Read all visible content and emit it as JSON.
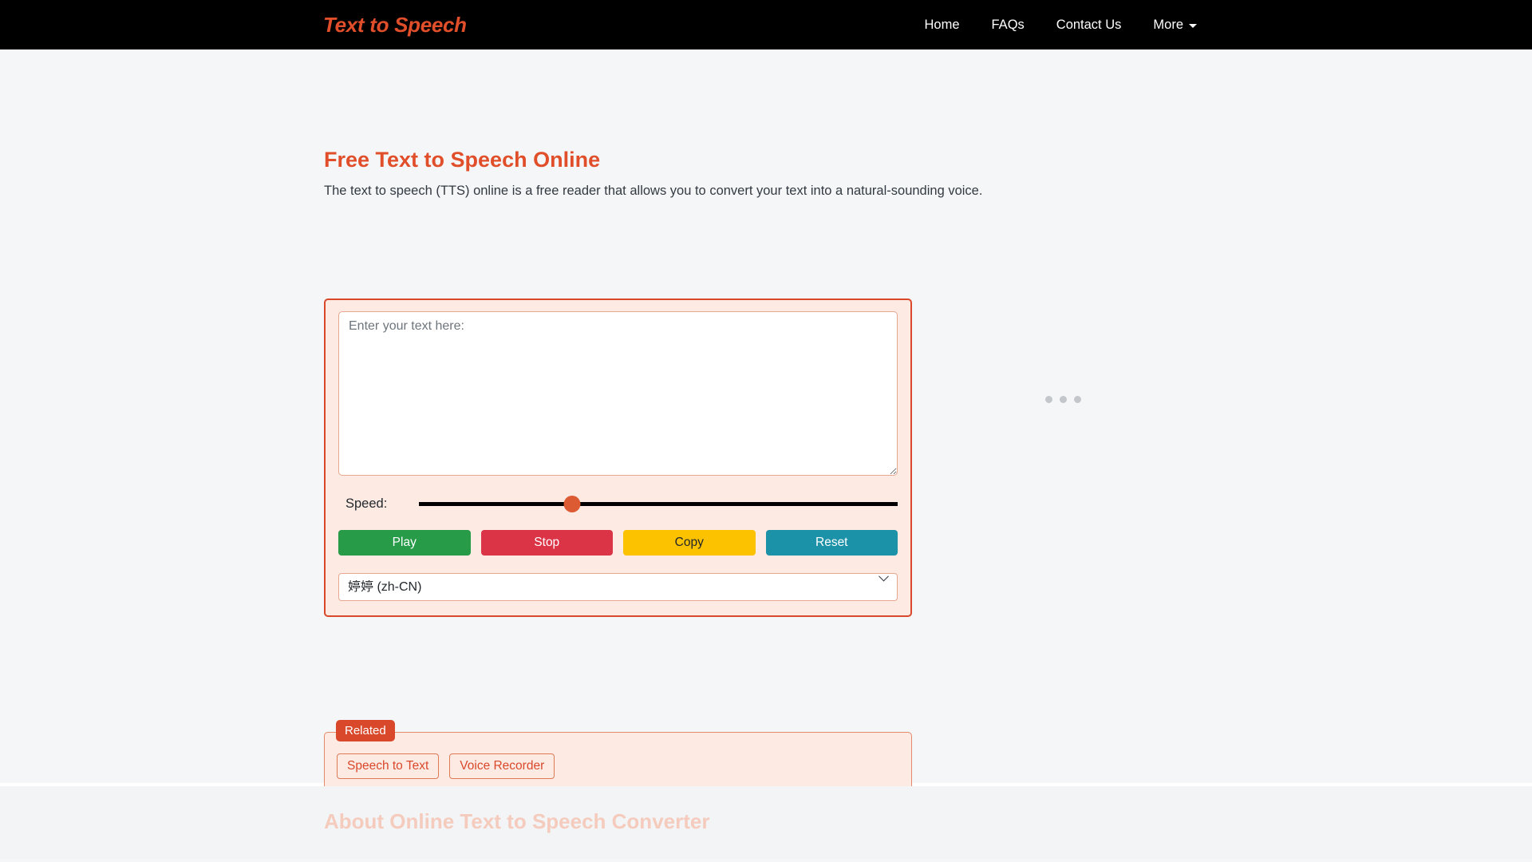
{
  "header": {
    "brand": "Text to Speech",
    "nav": [
      {
        "label": "Home",
        "name": "nav-home"
      },
      {
        "label": "FAQs",
        "name": "nav-faqs"
      },
      {
        "label": "Contact Us",
        "name": "nav-contact-us"
      },
      {
        "label": "More",
        "name": "nav-more",
        "has_caret": true
      }
    ]
  },
  "main": {
    "title": "Free Text to Speech Online",
    "subtitle": "The text to speech (TTS) online is a free reader that allows you to convert your text into a natural-sounding voice.",
    "textarea": {
      "placeholder": "Enter your text here:",
      "value": ""
    },
    "speed": {
      "label": "Speed:",
      "value": 32,
      "min": 0,
      "max": 100
    },
    "buttons": {
      "play": "Play",
      "stop": "Stop",
      "copy": "Copy",
      "reset": "Reset"
    },
    "voice_select": {
      "selected": "婷婷 (zh-CN)",
      "options": [
        "婷婷 (zh-CN)"
      ]
    }
  },
  "related": {
    "badge": "Related",
    "links": [
      {
        "label": "Speech to Text",
        "name": "related-link-speech-to-text"
      },
      {
        "label": "Voice Recorder",
        "name": "related-link-voice-recorder"
      }
    ]
  },
  "about": {
    "title": "About Online Text to Speech Converter"
  },
  "colors": {
    "brand_orange": "#e04e2a",
    "panel_border": "#d9482a",
    "panel_bg": "#fceae3",
    "play_green": "#279b48",
    "stop_red": "#dc3447",
    "copy_yellow": "#fcc200",
    "reset_teal": "#1c92a8",
    "page_bg": "#f5f6f8",
    "navbar_bg": "#000000"
  }
}
